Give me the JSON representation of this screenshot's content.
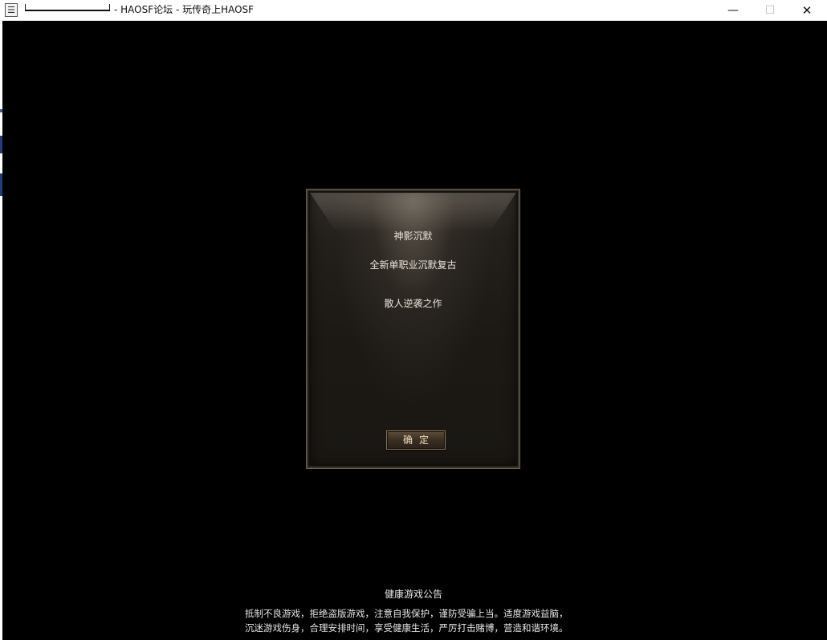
{
  "window": {
    "title": "- HAOSF论坛 - 玩传奇上HAOSF",
    "minimize_glyph": "—",
    "maximize_glyph": "☐",
    "close_glyph": "✕",
    "icons": [
      "app-icon",
      "minimize-icon",
      "maximize-icon",
      "close-icon"
    ]
  },
  "dialog": {
    "line1": "神影沉默",
    "line2": "全新单职业沉默复古",
    "line3": "散人逆袭之作",
    "ok_label": "确定"
  },
  "notice": {
    "title": "健康游戏公告",
    "line1": "抵制不良游戏，拒绝盗版游戏，注意自我保护，谨防受骗上当。适度游戏益脑，",
    "line2": "沉迷游戏伤身，合理安排时间，享受健康生活，严厉打击赌博，营造和谐环境。"
  },
  "colors": {
    "background": "#000000",
    "titlebar": "#ffffff",
    "dialog_text": "#e9e4da",
    "button_text": "#f1dcc0"
  }
}
